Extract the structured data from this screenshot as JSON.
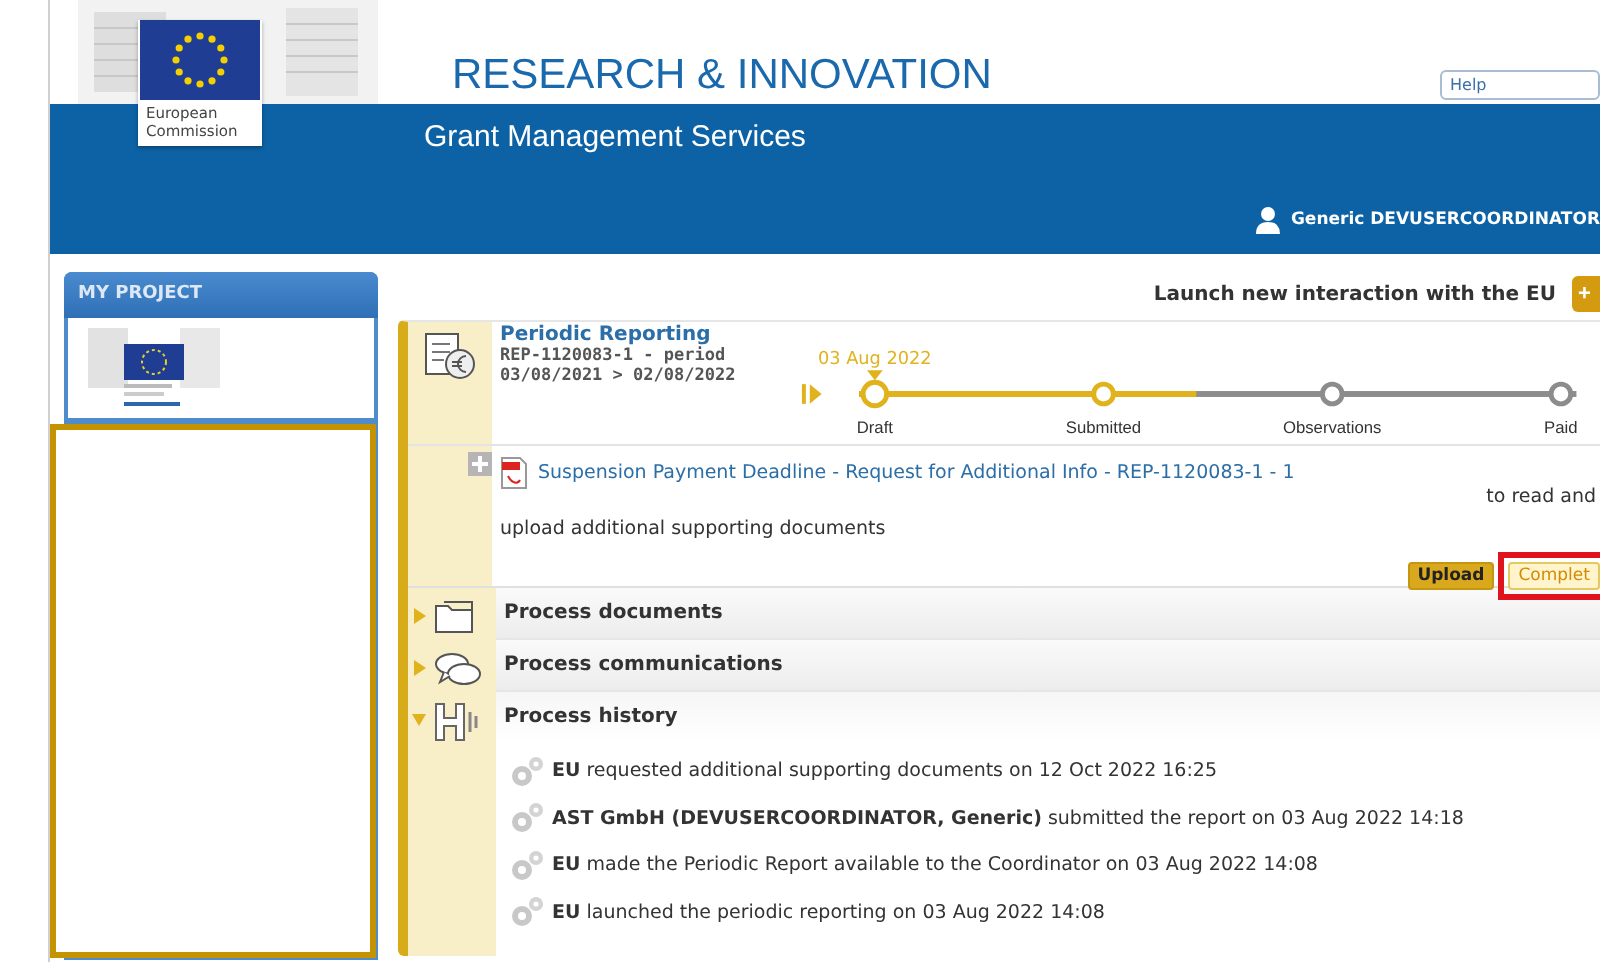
{
  "header": {
    "title": "RESEARCH & INNOVATION",
    "subtitle": "Grant Management Services",
    "logo_text": "European Commission",
    "help": {
      "placeholder": "Help"
    },
    "user": "Generic DEVUSERCOORDINATOR"
  },
  "sidebar": {
    "title": "MY PROJECT"
  },
  "main": {
    "launch_label": "Launch new interaction with the EU",
    "launch_button": "+",
    "process": {
      "title": "Periodic Reporting",
      "subtitle": "REP-1120083-1 - period 03/08/2021 > 02/08/2022",
      "timeline": {
        "level": 0.47,
        "steps": [
          {
            "label": "Draft",
            "done": true,
            "current": true,
            "date": "03 Aug 2022"
          },
          {
            "label": "Submitted",
            "done": true,
            "current": false
          },
          {
            "label": "Observations",
            "done": false,
            "current": false
          },
          {
            "label": "Paid",
            "done": false,
            "current": false
          }
        ]
      },
      "task": {
        "link": "Suspension Payment Deadline - Request for Additional Info - REP-1120083-1 - 1",
        "note": "to read and",
        "text": "upload additional supporting documents",
        "buttons": [
          {
            "label": "Upload",
            "kind": "primary",
            "highlighted": false
          },
          {
            "label": "Complet",
            "kind": "secondary",
            "highlighted": true
          }
        ]
      },
      "sections": [
        {
          "label": "Process documents",
          "kind": "documents",
          "expanded": false
        },
        {
          "label": "Process communications",
          "kind": "communications",
          "expanded": false
        },
        {
          "label": "Process history",
          "kind": "history",
          "expanded": true,
          "entries": [
            "**EU** requested additional supporting documents on 12 Oct 2022 16:25",
            "**AST GmbH (DEVUSERCOORDINATOR, Generic)** submitted the report on 03 Aug 2022 14:18",
            "**EU** made the Periodic Report available to the Coordinator on 03 Aug 2022 14:08",
            "**EU** launched the periodic reporting on 03 Aug 2022 14:08"
          ]
        }
      ]
    }
  }
}
